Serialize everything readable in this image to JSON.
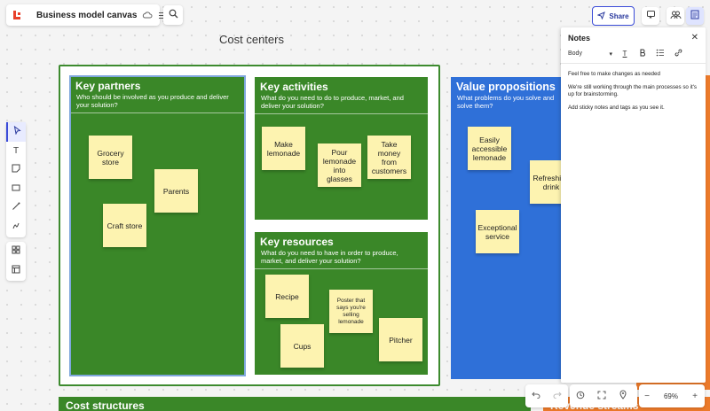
{
  "app": {
    "doc_title": "Business model canvas"
  },
  "header": {
    "share_label": "Share"
  },
  "canvas": {
    "cost_centers_heading": "Cost centers",
    "key_partners": {
      "title": "Key partners",
      "subtitle": "Who should be involved as you produce and deliver your solution?",
      "notes": [
        "Grocery store",
        "Parents",
        "Craft store"
      ]
    },
    "key_activities": {
      "title": "Key activities",
      "subtitle": "What do you need to do to produce, market, and deliver your solution?",
      "notes": [
        "Make lemonade",
        "Pour lemonade into glasses",
        "Take money from customers"
      ]
    },
    "key_resources": {
      "title": "Key resources",
      "subtitle": "What do you need to have in order to produce, market, and deliver your solution?",
      "notes": [
        "Recipe",
        "Poster that says you're selling lemonade",
        "Cups",
        "Pitcher"
      ]
    },
    "value_propositions": {
      "title": "Value propositions",
      "subtitle": "What problems do you solve and solve them?",
      "notes": [
        "Easily accessible lemonade",
        "Refreshing drink",
        "Exceptional service"
      ]
    },
    "cost_structures_title": "Cost structures",
    "revenue_streams_title": "Revenue streams"
  },
  "notes_panel": {
    "title": "Notes",
    "style_value": "Body",
    "paragraphs": [
      "Feel free to make changes as needed",
      "We're still working through the main processes so it's up for brainstorming.",
      "Add sticky notes and tags as you see it."
    ]
  },
  "zoom": {
    "value": "69%"
  },
  "colors": {
    "green": "#3a8728",
    "blue": "#2f70d8",
    "orange": "#ec7a2a",
    "sticky": "#fdf3b0",
    "accent": "#3a4bd8"
  }
}
